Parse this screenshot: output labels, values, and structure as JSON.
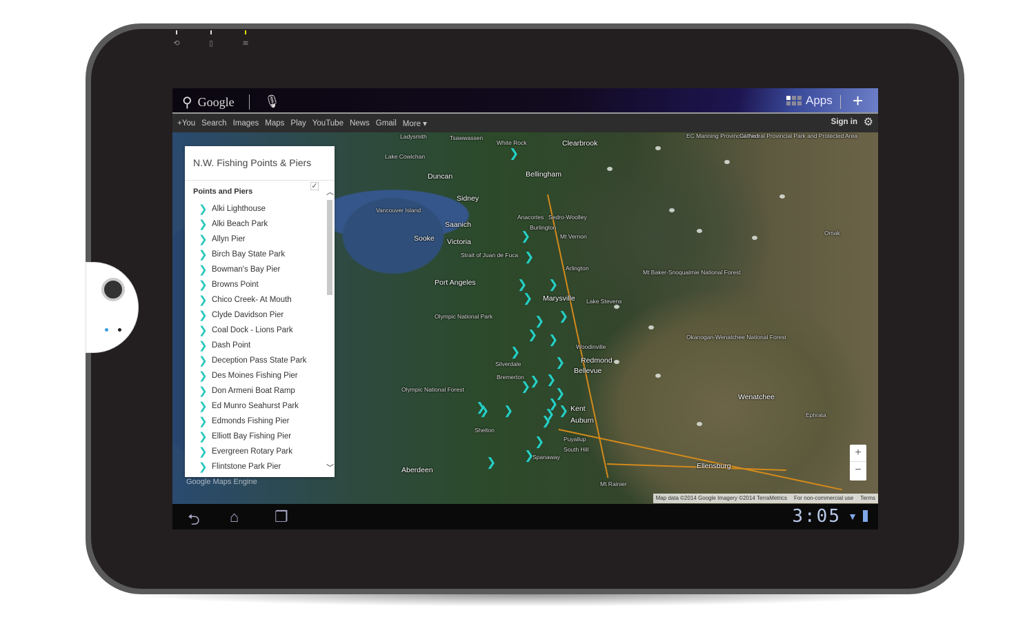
{
  "device": {
    "led_icons": [
      "rotate-icon",
      "phone-icon",
      "wifi-icon"
    ]
  },
  "google_bar": {
    "search_label": "Google",
    "apps_label": "Apps",
    "nav": [
      "+You",
      "Search",
      "Images",
      "Maps",
      "Play",
      "YouTube",
      "News",
      "Gmail",
      "More ▾"
    ],
    "sign_in": "Sign in"
  },
  "panel": {
    "title": "N.W. Fishing Points & Piers",
    "layer_name": "Points and Piers",
    "layer_checked": true,
    "items": [
      "Alki Lighthouse",
      "Alki Beach Park",
      "Allyn Pier",
      "Birch Bay State Park",
      "Bowman's Bay Pier",
      "Browns Point",
      "Chico Creek- At Mouth",
      "Clyde Davidson Pier",
      "Coal Dock - Lions Park",
      "Dash Point",
      "Deception Pass State Park",
      "Des Moines Fishing Pier",
      "Don Armeni Boat Ramp",
      "Ed Munro Seahurst Park",
      "Edmonds Fishing Pier",
      "Elliott Bay Fishing Pier",
      "Evergreen Rotary Park",
      "Flintstone Park Pier"
    ]
  },
  "map": {
    "labels": [
      "White Rock",
      "Clearbrook",
      "Bellingham",
      "Duncan",
      "Sidney",
      "Saanich",
      "Victoria",
      "Sooke",
      "Port Angeles",
      "Anacortes",
      "Sedro-Woolley",
      "Burlington",
      "Mt Vernon",
      "Arlington",
      "Marysville",
      "Lake Stevens",
      "Woodinville",
      "Redmond",
      "Bellevue",
      "Silverdale",
      "Bremerton",
      "Kent",
      "Auburn",
      "Puyallup",
      "South Hill",
      "Spanaway",
      "Shelton",
      "Aberdeen",
      "Ellensburg",
      "Wenatchee",
      "Ephrata",
      "Omak",
      "Olympic National Park",
      "Olympic National Forest",
      "Mt Baker-Snoqualmie National Forest",
      "Okanogan-Wenatchee National Forest",
      "Mt Rainier",
      "Tsawwassen",
      "Ladysmith",
      "Lake Cowichan",
      "Vancouver Island",
      "Strait of Juan de Fuca",
      "EC Manning Provincial Park",
      "Cathedral Provincial Park and Protected Area"
    ],
    "attribution": "Map data ©2014 Google Imagery ©2014 TerraMetrics",
    "noncommercial": "For non-commercial use",
    "terms": "Terms",
    "watermark": "Google Maps Engine",
    "zoom_in": "+",
    "zoom_out": "−",
    "marker_color": "#27d0c4"
  },
  "system_bar": {
    "time": "3:05"
  }
}
